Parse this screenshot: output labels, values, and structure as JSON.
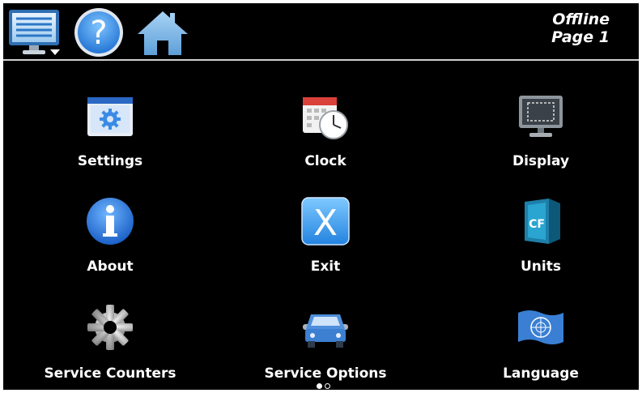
{
  "header": {
    "menu_icon": "monitor-menu-icon",
    "help_icon": "help-icon",
    "home_icon": "home-icon",
    "status": "Offline",
    "page": "Page 1"
  },
  "tiles": [
    {
      "label": "Settings",
      "icon": "settings-icon"
    },
    {
      "label": "Clock",
      "icon": "clock-icon"
    },
    {
      "label": "Display",
      "icon": "display-icon"
    },
    {
      "label": "About",
      "icon": "info-icon"
    },
    {
      "label": "Exit",
      "icon": "exit-icon"
    },
    {
      "label": "Units",
      "icon": "units-icon"
    },
    {
      "label": "Service Counters",
      "icon": "gear-icon"
    },
    {
      "label": "Service Options",
      "icon": "car-service-icon"
    },
    {
      "label": "Language",
      "icon": "un-flag-icon"
    }
  ],
  "pager": {
    "pages": 2,
    "current": 1
  },
  "colors": {
    "background": "#000000",
    "text": "#ffffff",
    "accent_blue": "#2f8ff0"
  }
}
